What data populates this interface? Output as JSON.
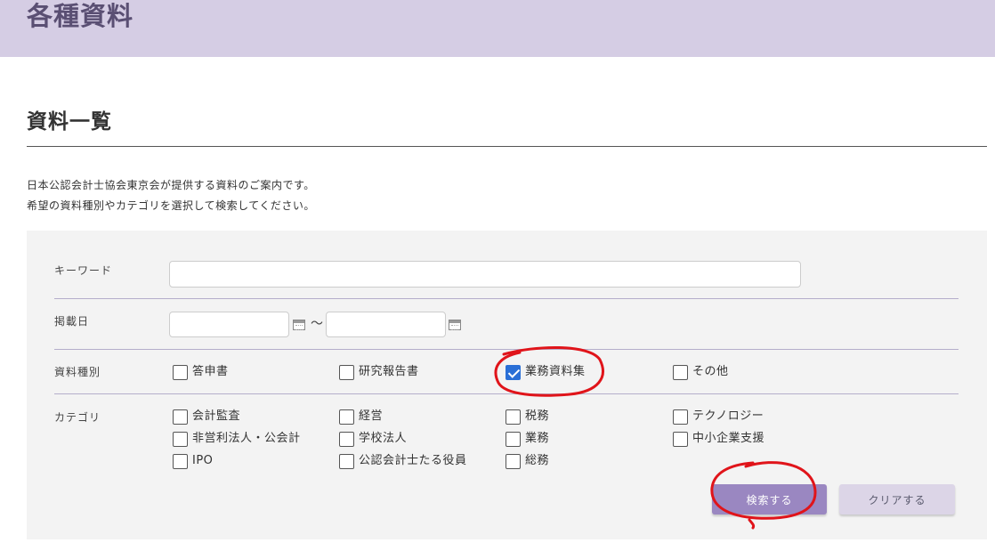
{
  "header": {
    "title": "各種資料"
  },
  "section": {
    "title": "資料一覧"
  },
  "intro": {
    "line1": "日本公認会計士協会東京会が提供する資料のご案内です。",
    "line2": "希望の資料種別やカテゴリを選択して検索してください。"
  },
  "form": {
    "keyword": {
      "label": "キーワード",
      "value": "",
      "placeholder": ""
    },
    "date": {
      "label": "掲載日",
      "from_value": "",
      "to_value": "",
      "separator": "〜"
    },
    "type": {
      "label": "資料種別",
      "options": [
        {
          "label": "答申書",
          "checked": false
        },
        {
          "label": "研究報告書",
          "checked": false
        },
        {
          "label": "業務資料集",
          "checked": true
        },
        {
          "label": "その他",
          "checked": false
        }
      ]
    },
    "category": {
      "label": "カテゴリ",
      "options": [
        {
          "label": "会計監査",
          "checked": false
        },
        {
          "label": "非営利法人・公会計",
          "checked": false
        },
        {
          "label": "IPO",
          "checked": false
        },
        {
          "label": "経営",
          "checked": false
        },
        {
          "label": "学校法人",
          "checked": false
        },
        {
          "label": "公認会計士たる役員",
          "checked": false
        },
        {
          "label": "税務",
          "checked": false
        },
        {
          "label": "業務",
          "checked": false
        },
        {
          "label": "総務",
          "checked": false
        },
        {
          "label": "テクノロジー",
          "checked": false
        },
        {
          "label": "中小企業支援",
          "checked": false
        }
      ]
    },
    "search_label": "検索する",
    "clear_label": "クリアする"
  },
  "colors": {
    "header_bg": "#d5cde4",
    "header_text": "#5a4f73",
    "panel_bg": "#f3f3f3",
    "divider": "#b5aecb",
    "search_button": "#9a87c1",
    "clear_button": "#dcd5e7",
    "checkbox_checked": "#2a6fd6",
    "annotation": "#e0141a"
  },
  "icons": {
    "date_from": "calendar-icon",
    "date_to": "calendar-icon"
  }
}
